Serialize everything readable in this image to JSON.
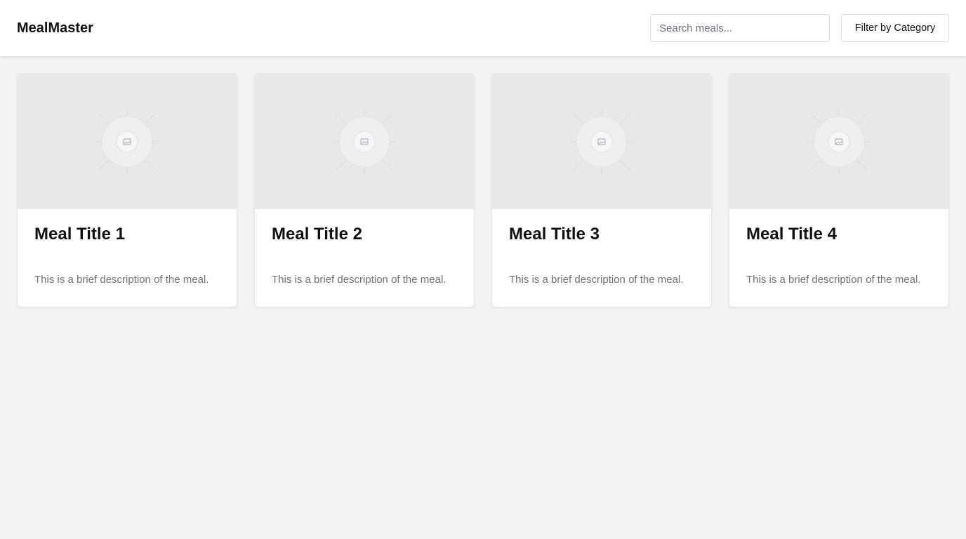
{
  "header": {
    "logo": "MealMaster",
    "search": {
      "placeholder": "Search meals...",
      "value": ""
    },
    "filter_label": "Filter by Category"
  },
  "meals": [
    {
      "title": "Meal Title 1",
      "description": "This is a brief description of the meal.",
      "image_icon": "image-placeholder-icon"
    },
    {
      "title": "Meal Title 2",
      "description": "This is a brief description of the meal.",
      "image_icon": "image-placeholder-icon"
    },
    {
      "title": "Meal Title 3",
      "description": "This is a brief description of the meal.",
      "image_icon": "image-placeholder-icon"
    },
    {
      "title": "Meal Title 4",
      "description": "This is a brief description of the meal.",
      "image_icon": "image-placeholder-icon"
    }
  ],
  "colors": {
    "page_background": "#f2f3f5",
    "card_background": "#ffffff",
    "image_placeholder": "#e9e9ea",
    "muted_text": "#6b7280",
    "border": "#d9dbe0"
  }
}
